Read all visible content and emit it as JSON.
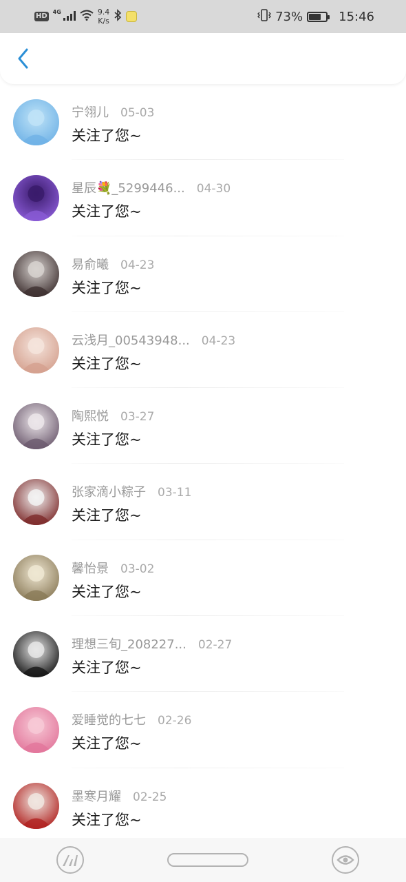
{
  "status_bar": {
    "hd": "HD",
    "network": "4G",
    "speed_value": "9.4",
    "speed_unit": "K/s",
    "battery_percent": "73%",
    "battery_level": 0.73,
    "time": "15:46"
  },
  "header": {
    "back_icon": "chevron-left-icon",
    "accent_color": "#2b8fd6"
  },
  "notifications": [
    {
      "name": "宁翎儿",
      "date": "05-03",
      "message": "关注了您~",
      "avatar_colors": [
        "#bfe3f7",
        "#6fb2e6"
      ]
    },
    {
      "name": "星辰💐_5299446...",
      "date": "04-30",
      "message": "关注了您~",
      "avatar_colors": [
        "#3a1b6b",
        "#8a5bd6"
      ]
    },
    {
      "name": "易俞曦",
      "date": "04-23",
      "message": "关注了您~",
      "avatar_colors": [
        "#d7d2cf",
        "#3d2f2f"
      ]
    },
    {
      "name": "云浅月_00543948...",
      "date": "04-23",
      "message": "关注了您~",
      "avatar_colors": [
        "#f5e4dc",
        "#d4a08e"
      ]
    },
    {
      "name": "陶熙悦",
      "date": "03-27",
      "message": "关注了您~",
      "avatar_colors": [
        "#ece6ea",
        "#6c5a6e"
      ]
    },
    {
      "name": "张家滴小粽子",
      "date": "03-11",
      "message": "关注了您~",
      "avatar_colors": [
        "#f2f2f2",
        "#7d2b2b"
      ]
    },
    {
      "name": "馨怡景",
      "date": "03-02",
      "message": "关注了您~",
      "avatar_colors": [
        "#efe7d2",
        "#8a7a58"
      ]
    },
    {
      "name": "理想三旬_208227...",
      "date": "02-27",
      "message": "关注了您~",
      "avatar_colors": [
        "#e6e6e6",
        "#151515"
      ]
    },
    {
      "name": "爱睡觉的七七",
      "date": "02-26",
      "message": "关注了您~",
      "avatar_colors": [
        "#f7c9d6",
        "#e2769b"
      ]
    },
    {
      "name": "墨寒月耀",
      "date": "02-25",
      "message": "关注了您~",
      "avatar_colors": [
        "#f0e6e0",
        "#b0211f"
      ]
    }
  ],
  "nav_bar": {
    "left_icon": "app-logo-icon",
    "center_icon": "home-pill",
    "right_icon": "eye-icon"
  }
}
